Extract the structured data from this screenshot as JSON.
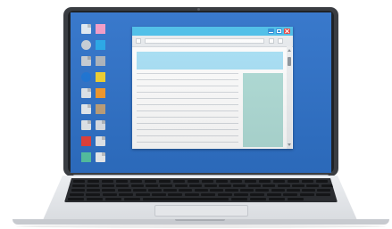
{
  "colors": {
    "desktop_background": "#2f72c9",
    "window_titlebar": "#4bbfe9",
    "banner": "#a9e1f7",
    "sidebar_panel": "#b0ddd7",
    "close_button": "#e8413c",
    "bezel": "#3a3d42",
    "keyboard": "#2a2c30"
  },
  "desktop": {
    "icons": [
      {
        "name": "trash-icon",
        "color": "#dfe8f1",
        "shape": "doc"
      },
      {
        "name": "pink-folder-icon",
        "color": "#f29ac6",
        "shape": "square"
      },
      {
        "name": "disc-icon",
        "color": "#c7ced6",
        "shape": "round"
      },
      {
        "name": "blue-folder-icon",
        "color": "#25a7e8",
        "shape": "square"
      },
      {
        "name": "gray-doc-icon",
        "color": "#c9ced4",
        "shape": "doc"
      },
      {
        "name": "gray-square-icon",
        "color": "#aeb5bd",
        "shape": "square"
      },
      {
        "name": "globe-icon",
        "color": "#1b74d6",
        "shape": "round"
      },
      {
        "name": "yellow-folder-icon",
        "color": "#f2d12e",
        "shape": "square"
      },
      {
        "name": "light-doc-icon",
        "color": "#e3e8ee",
        "shape": "doc"
      },
      {
        "name": "orange-folder-icon",
        "color": "#f59a2b",
        "shape": "square"
      },
      {
        "name": "chart-icon",
        "color": "#e9eef3",
        "shape": "doc"
      },
      {
        "name": "tan-folder-icon",
        "color": "#bfa17a",
        "shape": "square"
      },
      {
        "name": "file-icon",
        "color": "#e6ebf0",
        "shape": "doc"
      },
      {
        "name": "file-icon-2",
        "color": "#dde3ea",
        "shape": "doc"
      },
      {
        "name": "red-folder-icon",
        "color": "#e8413c",
        "shape": "square"
      },
      {
        "name": "note-icon",
        "color": "#e9edf2",
        "shape": "doc"
      },
      {
        "name": "teal-folder-icon",
        "color": "#57c7a7",
        "shape": "square"
      },
      {
        "name": "pie-chart-icon",
        "color": "#f1f4f7",
        "shape": "doc"
      }
    ]
  },
  "window": {
    "buttons": [
      "minimize-icon",
      "maximize-icon",
      "close-icon"
    ],
    "toolbar_icons": [
      "home-icon",
      "bookmark-icon",
      "menu-icon"
    ],
    "text_line_count": 12
  }
}
